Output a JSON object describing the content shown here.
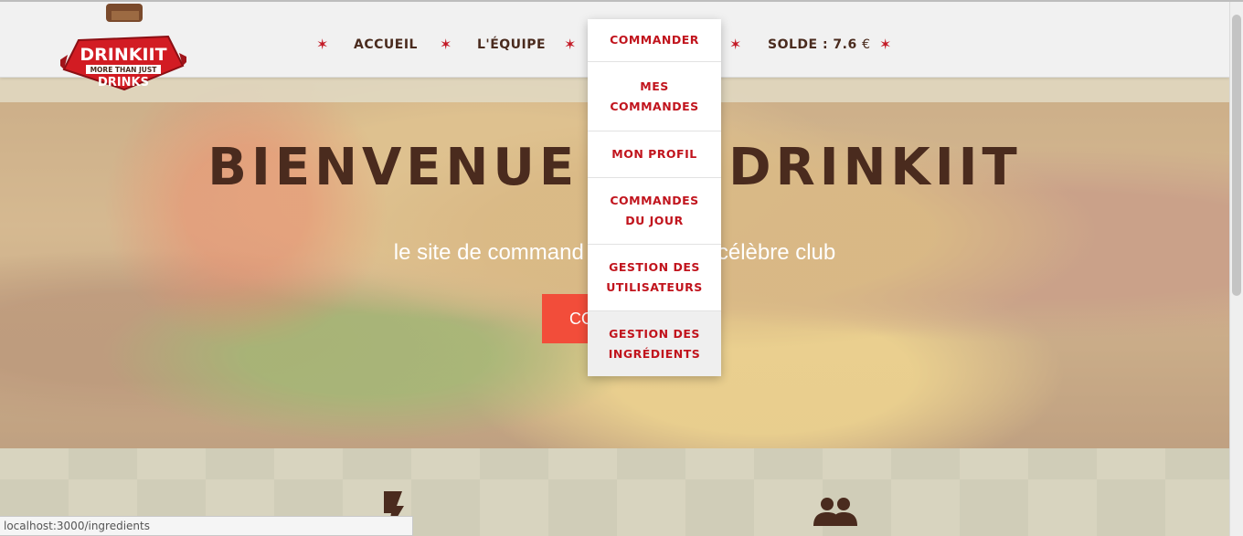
{
  "logo": {
    "line1": "DRINKIIT",
    "line2": "MORE THAN JUST",
    "line3": "DRINKS"
  },
  "nav": {
    "items": [
      {
        "label": "ACCUEIL"
      },
      {
        "label": "L'ÉQUIPE"
      },
      {
        "label": "SOLDE : 7.6",
        "currency": "€"
      }
    ]
  },
  "dropdown": {
    "items": [
      {
        "line1": "COMMANDER",
        "line2": ""
      },
      {
        "line1": "MES",
        "line2": "COMMANDES"
      },
      {
        "line1": "MON PROFIL",
        "line2": ""
      },
      {
        "line1": "COMMANDES",
        "line2": "DU JOUR"
      },
      {
        "line1": "GESTION DES",
        "line2": "UTILISATEURS"
      },
      {
        "line1": "GESTION DES",
        "line2": "INGRÉDIENTS"
      }
    ]
  },
  "hero": {
    "title_left": "BIENVENUE",
    "title_right": "DRINKIIT",
    "subtitle_left": "le site de command",
    "subtitle_right": "célèbre club",
    "button_label": "CO"
  },
  "status_bar": {
    "url": "localhost:3000/ingredients"
  },
  "icons": {
    "star": "star-icon",
    "bolt": "bolt-icon",
    "users": "users-icon"
  },
  "colors": {
    "brown": "#4a2b1e",
    "red": "#c1141d",
    "orange_button": "#f24d3a"
  }
}
